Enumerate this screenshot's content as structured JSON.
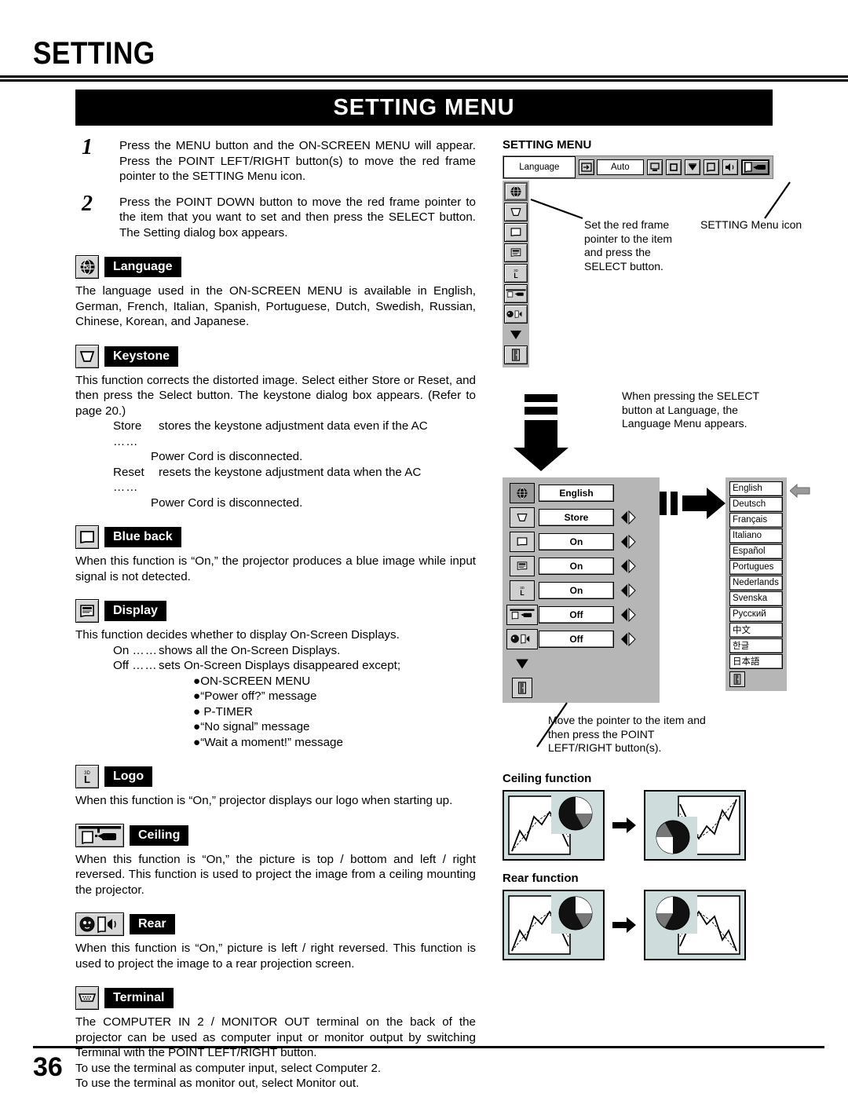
{
  "page": {
    "chapter_title": "SETTING",
    "banner": "SETTING MENU",
    "page_number": "36"
  },
  "steps": [
    {
      "num": "1",
      "text": "Press the MENU button and the ON-SCREEN MENU will appear.  Press the POINT LEFT/RIGHT button(s) to move the red frame pointer to the SETTING Menu icon."
    },
    {
      "num": "2",
      "text": "Press the POINT DOWN button to move the red frame pointer to the item that you want to set and then press the SELECT button.  The Setting dialog box appears."
    }
  ],
  "sections": {
    "language": {
      "label": "Language",
      "icon": "globe-icon",
      "body": "The language used in the ON-SCREEN MENU is available in English, German, French, Italian, Spanish, Portuguese, Dutch, Swedish, Russian, Chinese, Korean, and Japanese."
    },
    "keystone": {
      "label": "Keystone",
      "icon": "keystone-icon",
      "body": "This function corrects the distorted image.  Select either Store or Reset, and then press the Select button.  The keystone dialog box appears.  (Refer to page 20.)",
      "store_key": "Store",
      "store_dots": "……",
      "store_desc": "stores the keystone adjustment data even if the AC",
      "store_desc2": "Power Cord is disconnected.",
      "reset_key": "Reset",
      "reset_dots": "……",
      "reset_desc": "resets the keystone adjustment data when the AC",
      "reset_desc2": "Power Cord is disconnected."
    },
    "blue_back": {
      "label": "Blue back",
      "icon": "blue-back-icon",
      "body": "When this function is “On,” the projector produces a blue image while input signal is not detected."
    },
    "display": {
      "label": "Display",
      "icon": "display-icon",
      "body": "This function decides whether to display On-Screen Displays.",
      "on_key": "On",
      "on_dots": "……",
      "on_desc": "shows all the On-Screen Displays.",
      "off_key": "Off",
      "off_dots": "……",
      "off_desc": "sets On-Screen Displays disappeared except;",
      "bullets": [
        "ON-SCREEN MENU",
        "“Power off?” message",
        "P-TIMER",
        "“No signal” message",
        "“Wait a moment!” message"
      ]
    },
    "logo": {
      "label": "Logo",
      "icon": "logo-icon",
      "body": "When this function is “On,” projector displays our logo when starting up."
    },
    "ceiling": {
      "label": "Ceiling",
      "icon": "ceiling-icon",
      "body": "When this function is “On,” the picture is top / bottom and left / right reversed.  This function is used to project the image from a ceiling mounting the  projector."
    },
    "rear": {
      "label": "Rear",
      "icon": "rear-icon",
      "body": "When this function is “On,” picture is left / right reversed.  This function is used to project the image to a rear projection screen."
    },
    "terminal": {
      "label": "Terminal",
      "icon": "terminal-icon",
      "body": "The COMPUTER IN 2 / MONITOR OUT terminal on the back of the projector can be used as computer input or monitor output by switching Terminal with the POINT LEFT/RIGHT button.",
      "line2": "To use the terminal as computer input, select Computer 2.",
      "line3": "To use the terminal as monitor out, select Monitor out."
    }
  },
  "osd": {
    "title": "SETTING MENU",
    "menubar": {
      "language_box": "Language",
      "auto_box": "Auto",
      "icons": [
        "input-icon",
        "computer-icon",
        "square-icon",
        "image-icon",
        "screen-icon",
        "sound-icon",
        "setting-icon"
      ]
    },
    "callout_pointer": "Set the red frame pointer to the item and press the SELECT button.",
    "callout_menu_icon": "SETTING Menu icon",
    "callout_select": "When pressing the SELECT button at Language, the Language Menu appears.",
    "callout_move": "Move the pointer to the item and then press the POINT LEFT/RIGHT button(s).",
    "dialog_rows": [
      {
        "icon": "globe-icon",
        "value": "English",
        "arrows": false
      },
      {
        "icon": "keystone-icon",
        "value": "Store",
        "arrows": true
      },
      {
        "icon": "blue-back-icon",
        "value": "On",
        "arrows": true
      },
      {
        "icon": "display-icon",
        "value": "On",
        "arrows": true
      },
      {
        "icon": "logo-icon",
        "value": "On",
        "arrows": true
      },
      {
        "icon": "ceiling-icon",
        "value": "Off",
        "arrows": true
      },
      {
        "icon": "rear-icon",
        "value": "Off",
        "arrows": true
      }
    ],
    "languages": [
      "English",
      "Deutsch",
      "Français",
      "Italiano",
      "Español",
      "Portugues",
      "Nederlands",
      "Svenska",
      "Русский",
      "中文",
      "한글",
      "日本語"
    ]
  },
  "figures": {
    "ceiling_title": "Ceiling function",
    "rear_title": "Rear function"
  },
  "colors": {
    "banner_bg": "#000000",
    "banner_fg": "#ffffff",
    "osd_gray": "#b6b6b6",
    "figure_fill": "#cfdcdc"
  }
}
